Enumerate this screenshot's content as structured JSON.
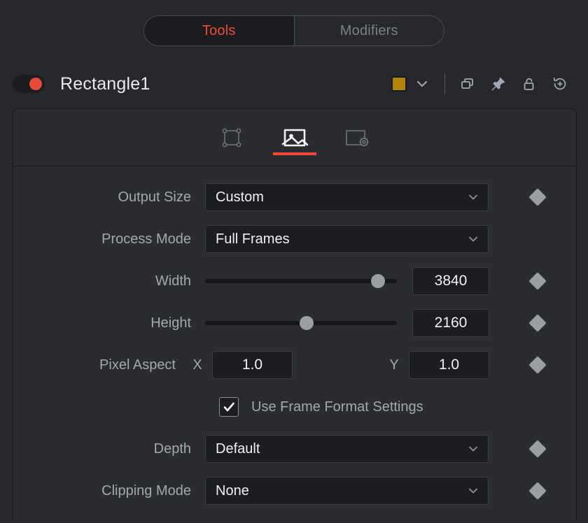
{
  "tabs_top": {
    "active": "Tools",
    "items": [
      {
        "label": "Tools",
        "active": true
      },
      {
        "label": "Modifiers",
        "active": false
      }
    ]
  },
  "node_header": {
    "enabled_toggle": "node-enable-toggle",
    "name": "Rectangle1",
    "color_swatch": "#b5820a",
    "icons": [
      "chevron-down-icon",
      "duplicate-icon",
      "pin-icon",
      "unlock-icon",
      "reset-add-icon"
    ]
  },
  "tool_tabs": {
    "items": [
      {
        "icon": "shape-controls-icon",
        "active": false
      },
      {
        "icon": "image-icon",
        "active": true
      },
      {
        "icon": "frame-settings-icon",
        "active": false
      }
    ],
    "accent": "#f04a37"
  },
  "properties": {
    "output_size": {
      "label": "Output Size",
      "value": "Custom",
      "keyframe": true
    },
    "process_mode": {
      "label": "Process Mode",
      "value": "Full Frames",
      "keyframe": false
    },
    "width": {
      "label": "Width",
      "value": "3840",
      "slider_percent": 90,
      "keyframe": true
    },
    "height": {
      "label": "Height",
      "value": "2160",
      "slider_percent": 53,
      "keyframe": true
    },
    "pixel_aspect": {
      "label": "Pixel Aspect",
      "x_label": "X",
      "x_value": "1.0",
      "y_label": "Y",
      "y_value": "1.0",
      "keyframe": true
    },
    "use_frame_format": {
      "label": "Use Frame Format Settings",
      "checked": true,
      "check_glyph": "✓"
    },
    "depth": {
      "label": "Depth",
      "value": "Default",
      "keyframe": true
    },
    "clipping_mode": {
      "label": "Clipping Mode",
      "value": "None",
      "keyframe": true
    }
  }
}
